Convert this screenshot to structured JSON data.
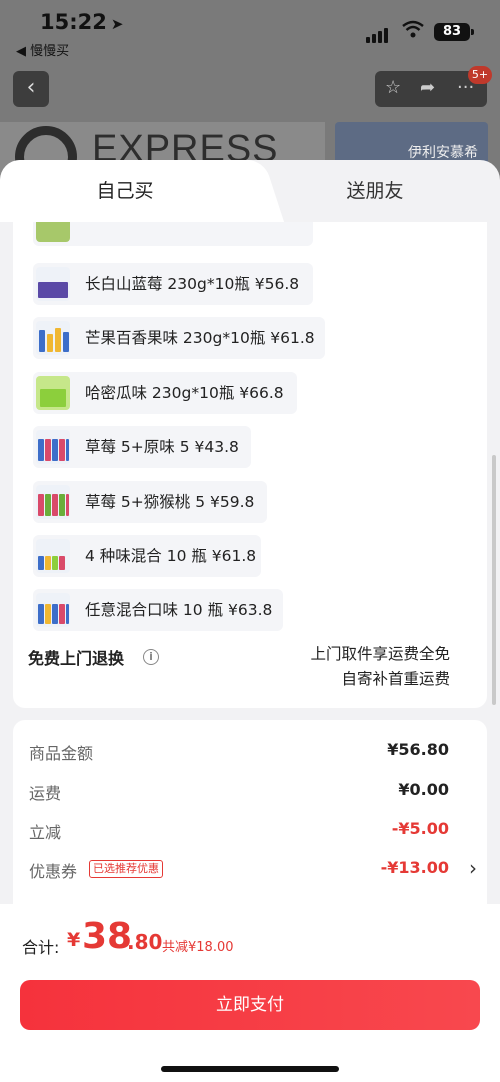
{
  "status_bar": {
    "time": "15:22",
    "back_app": "◀ 慢慢买",
    "battery": "83"
  },
  "bg": {
    "brand_text": "EXPRESS",
    "card_text": "伊利安慕希",
    "badge": "5+"
  },
  "tabs": {
    "self_buy": "自己买",
    "gift": "送朋友"
  },
  "products": [
    {
      "label": "长白山蓝莓 230g*10瓶  ¥56.8",
      "color": "#5a49a6"
    },
    {
      "label": "芒果百香果味 230g*10瓶  ¥61.8",
      "color": "#f0b732"
    },
    {
      "label": "哈密瓜味 230g*10瓶  ¥66.8",
      "color": "#8ccf3c"
    },
    {
      "label": "草莓 5+原味 5  ¥43.8",
      "color": "#d94a6a"
    },
    {
      "label": "草莓 5+猕猴桃 5  ¥59.8",
      "color": "#6aae3a"
    },
    {
      "label": "4 种味混合 10 瓶  ¥61.8",
      "color": "#3d6ec9"
    },
    {
      "label": "任意混合口味 10 瓶  ¥63.8",
      "color": "#3d6ec9"
    }
  ],
  "return_service": {
    "title": "免费上门退换",
    "note_line1": "上门取件享运费全免",
    "note_line2": "自寄补首重运费"
  },
  "price_breakdown": {
    "goods_label": "商品金额",
    "goods_value": "¥56.80",
    "shipping_label": "运费",
    "shipping_value": "¥0.00",
    "discount_label": "立减",
    "discount_value": "-¥5.00",
    "coupon_label": "优惠券",
    "coupon_badge": "已选推荐优惠",
    "coupon_value": "-¥13.00"
  },
  "footer": {
    "total_label": "合计:",
    "currency": "¥",
    "total_int": "38",
    "total_dec": ".80",
    "saved": "共减¥18.00",
    "pay_button": "立即支付"
  }
}
